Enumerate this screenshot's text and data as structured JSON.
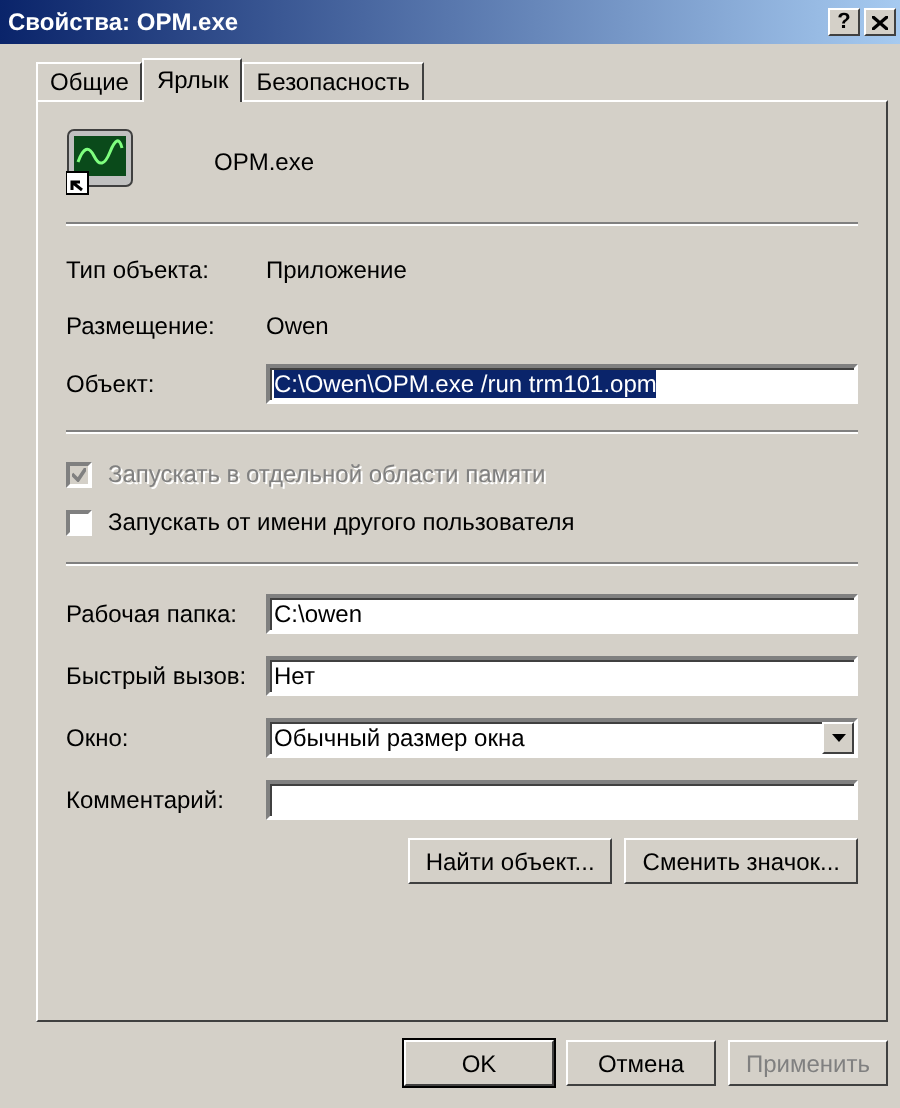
{
  "window": {
    "title": "Свойства: OPM.exe",
    "help": "?"
  },
  "tabs": [
    {
      "label": "Общие",
      "selected": false
    },
    {
      "label": "Ярлык",
      "selected": true
    },
    {
      "label": "Безопасность",
      "selected": false
    }
  ],
  "header": {
    "name": "OPM.exe"
  },
  "info": [
    {
      "label": "Тип объекта:",
      "value": "Приложение"
    },
    {
      "label": "Размещение:",
      "value": "Owen"
    }
  ],
  "target": {
    "label": "Объект:",
    "value": "C:\\Owen\\OPM.exe /run trm101.opm",
    "selected": true
  },
  "checkboxes": [
    {
      "label": "Запускать в отдельной области памяти",
      "checked": true,
      "disabled": true
    },
    {
      "label": "Запускать от имени другого пользователя",
      "checked": false,
      "disabled": false
    }
  ],
  "fields": [
    {
      "kind": "text",
      "label": "Рабочая папка:",
      "value": "C:\\owen"
    },
    {
      "kind": "text",
      "label": "Быстрый вызов:",
      "value": "Нет"
    },
    {
      "kind": "select",
      "label": "Окно:",
      "value": "Обычный размер окна"
    },
    {
      "kind": "text",
      "label": "Комментарий:"
    }
  ],
  "actions": [
    {
      "label": "Найти объект..."
    },
    {
      "label": "Сменить значок..."
    }
  ],
  "buttons": [
    {
      "label": "OK",
      "disabled": false,
      "default": true
    },
    {
      "label": "Отмена",
      "disabled": false,
      "default": false
    },
    {
      "label": "Применить",
      "disabled": true,
      "default": false
    }
  ]
}
